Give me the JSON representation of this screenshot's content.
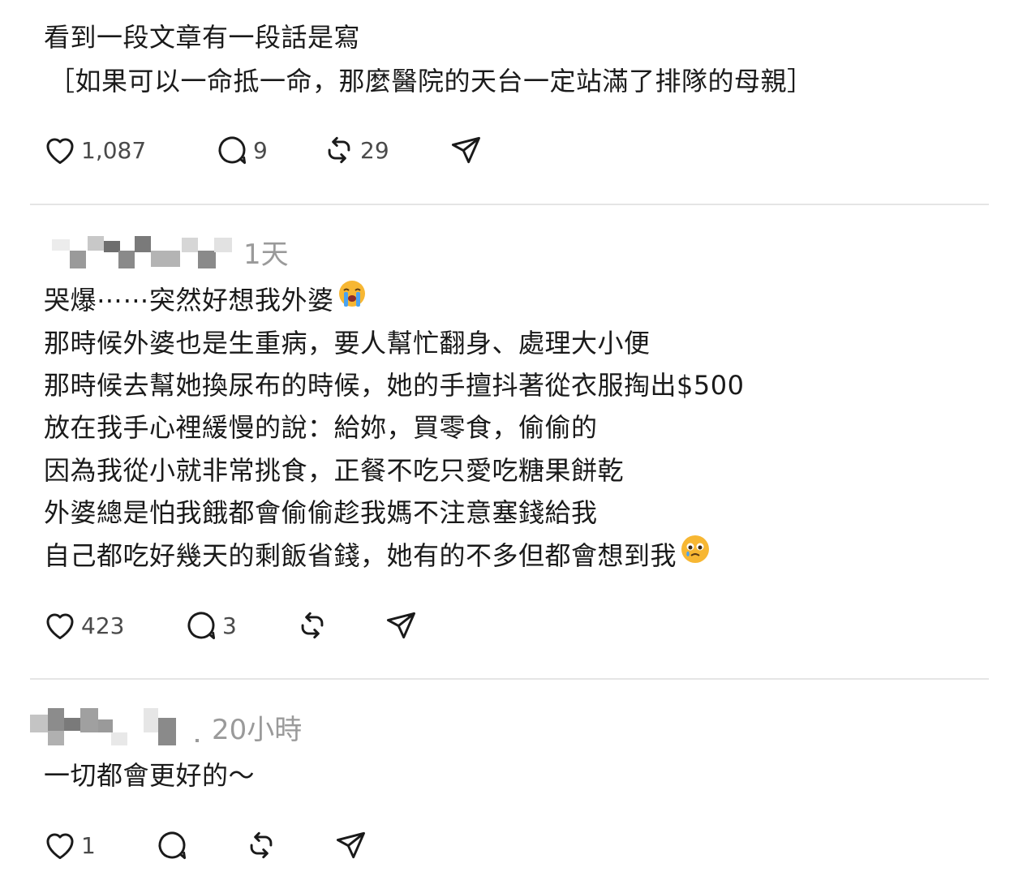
{
  "post": {
    "lines": [
      "看到一段文章有一段話是寫",
      "［如果可以一命抵一命，那麼醫院的天台一定站滿了排隊的母親］"
    ],
    "likes": "1,087",
    "comments": "9",
    "reposts": "29"
  },
  "reply1": {
    "timestamp": "1天",
    "lines": [
      "哭爆⋯⋯突然好想我外婆",
      "那時候外婆也是生重病，要人幫忙翻身、處理大小便",
      "那時候去幫她換尿布的時候，她的手擅抖著從衣服掏出$500",
      "放在我手心裡緩慢的說：給妳，買零食，偷偷的",
      "因為我從小就非常挑食，正餐不吃只愛吃糖果餅乾",
      "外婆總是怕我餓都會偷偷趁我媽不注意塞錢給我",
      "自己都吃好幾天的剩飯省錢，她有的不多但都會想到我"
    ],
    "emoji_1": "loudly-crying-face",
    "emoji_2": "face-holding-back-tears",
    "likes": "423",
    "comments": "3",
    "reposts": ""
  },
  "reply2": {
    "timestamp": "20小時",
    "lines": [
      "一切都會更好的～"
    ],
    "likes": "1",
    "comments": "",
    "reposts": ""
  },
  "colors": {
    "text": "#1a1a1a",
    "muted": "#9a9a9a",
    "divider": "#e5e5e5",
    "icon": "#1a1a1a"
  }
}
